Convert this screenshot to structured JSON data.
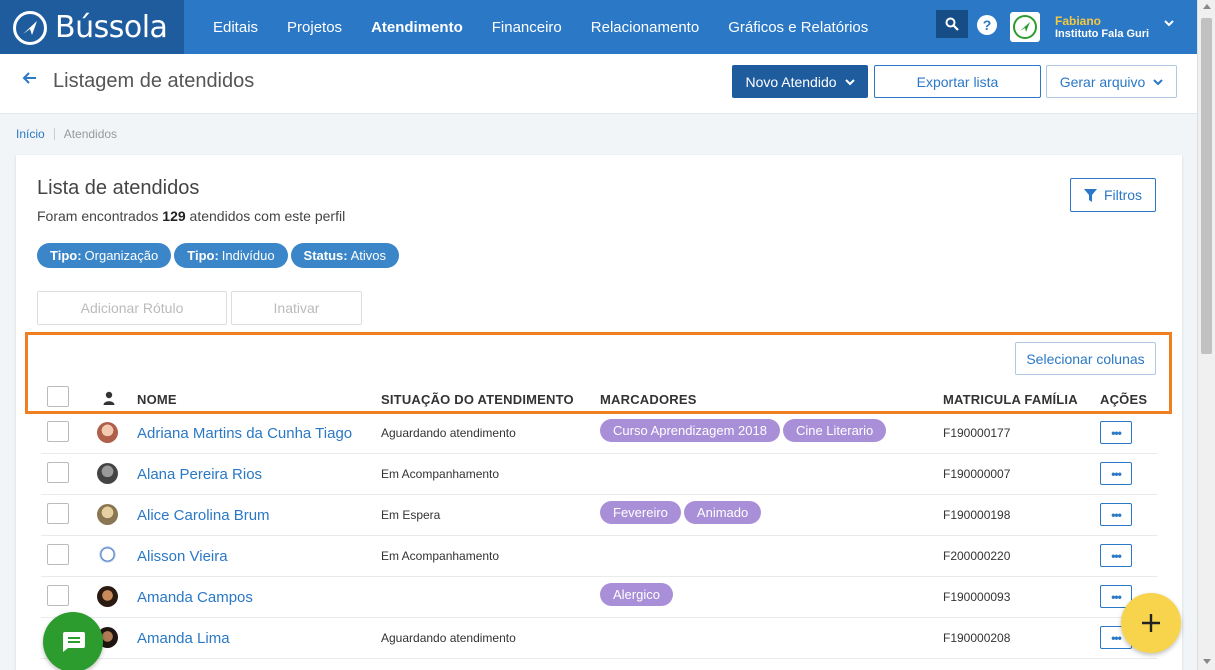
{
  "brand": {
    "name": "Bússola"
  },
  "nav": {
    "items": [
      {
        "label": "Editais",
        "active": false
      },
      {
        "label": "Projetos",
        "active": false
      },
      {
        "label": "Atendimento",
        "active": true
      },
      {
        "label": "Financeiro",
        "active": false
      },
      {
        "label": "Relacionamento",
        "active": false
      },
      {
        "label": "Gráficos e Relatórios",
        "active": false
      }
    ],
    "help_label": "?",
    "user_name": "Fabiano",
    "user_org": "Instituto Fala Guri"
  },
  "header": {
    "title": "Listagem de atendidos",
    "novo_label": "Novo Atendido",
    "exportar_label": "Exportar lista",
    "gerar_label": "Gerar arquivo"
  },
  "breadcrumb": {
    "home": "Início",
    "current": "Atendidos"
  },
  "card": {
    "title": "Lista de atendidos",
    "sub_prefix": "Foram encontrados",
    "count": "129",
    "sub_suffix": "atendidos com este perfil",
    "filtros_label": "Filtros",
    "filters": [
      {
        "key": "Tipo:",
        "value": "Organização"
      },
      {
        "key": "Tipo:",
        "value": "Indivíduo"
      },
      {
        "key": "Status:",
        "value": "Ativos"
      }
    ],
    "adicionar_label": "Adicionar Rótulo",
    "inativar_label": "Inativar",
    "colunas_label": "Selecionar colunas"
  },
  "table": {
    "columns": {
      "nome": "NOME",
      "situacao": "SITUAÇÃO DO ATENDIMENTO",
      "marcadores": "MARCADORES",
      "matricula": "MATRICULA FAMÍLIA",
      "acoes": "AÇÕES"
    },
    "actions_label": "•••",
    "rows": [
      {
        "name": "Adriana Martins da Cunha Tiago",
        "status": "Aguardando atendimento",
        "tags": [
          "Curso Aprendizagem 2018",
          "Cine Literario"
        ],
        "matricula": "F190000177"
      },
      {
        "name": "Alana Pereira Rios",
        "status": "Em Acompanhamento",
        "tags": [],
        "matricula": "F190000007"
      },
      {
        "name": "Alice Carolina Brum",
        "status": "Em Espera",
        "tags": [
          "Fevereiro",
          "Animado"
        ],
        "matricula": "F190000198"
      },
      {
        "name": "Alisson Vieira",
        "status": "Em Acompanhamento",
        "tags": [],
        "matricula": "F200000220"
      },
      {
        "name": "Amanda Campos",
        "status": "",
        "tags": [
          "Alergico"
        ],
        "matricula": "F190000093"
      },
      {
        "name": "Amanda Lima",
        "status": "Aguardando atendimento",
        "tags": [],
        "matricula": "F190000208"
      }
    ]
  },
  "colors": {
    "nav_bg": "#2a78c6",
    "brand_bg": "#1f5c9e",
    "primary": "#1f5c9e",
    "link": "#2a78c6",
    "chip": "#3a86c8",
    "tag": "#a98fd8",
    "highlight": "#f07f22",
    "chat_fab": "#2d9c2e",
    "add_fab": "#f7d44c"
  }
}
